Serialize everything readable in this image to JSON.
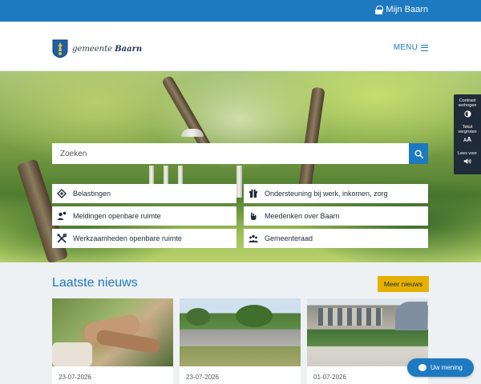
{
  "topbar": {
    "login_label": "Mijn Baarn",
    "icon": "lock-icon",
    "color": "#1d79c0"
  },
  "header": {
    "logo_prefix": "gemeente",
    "logo_name": "Baarn",
    "menu_label": "MENU"
  },
  "search": {
    "placeholder": "Zoeken"
  },
  "tiles": [
    {
      "label": "Belastingen",
      "icon": "belastingen-icon"
    },
    {
      "label": "Ondersteuning bij werk, inkomen, zorg",
      "icon": "ondersteuning-icon"
    },
    {
      "label": "Meldingen openbare ruimte",
      "icon": "meldingen-icon"
    },
    {
      "label": "Meedenken over Baarn",
      "icon": "meedenken-icon"
    },
    {
      "label": "Werkzaamheden openbare ruimte",
      "icon": "werkzaamheden-icon"
    },
    {
      "label": "Gemeenteraad",
      "icon": "gemeenteraad-icon"
    }
  ],
  "accessibility": {
    "contrast": "Contrast verhogen",
    "text_size": "Tekst vergroten",
    "text_size_symbol": "A",
    "read_aloud": "Lees voor"
  },
  "news": {
    "title": "Laatste nieuws",
    "more_label": "Meer nieuws",
    "cards": [
      {
        "date": "23-07-2026"
      },
      {
        "date": "23-07-2026"
      },
      {
        "date": "01-07-2026"
      }
    ]
  },
  "feedback": {
    "label": "Uw mening"
  },
  "colors": {
    "accent": "#1d79c0",
    "highlight": "#e5b100",
    "panel": "#1f2b38"
  }
}
